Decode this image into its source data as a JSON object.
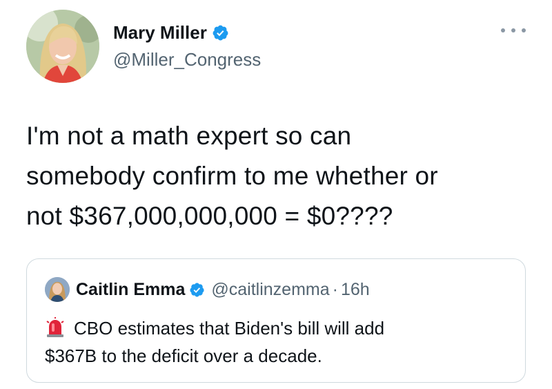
{
  "author": {
    "display_name": "Mary Miller",
    "handle": "@Miller_Congress",
    "verified": true,
    "avatar": "avatar-photo"
  },
  "header": {
    "more_icon": "more-horizontal-icon"
  },
  "tweet": {
    "lines": [
      "I'm not a math expert so can",
      "somebody confirm to me whether or",
      "not $367,000,000,000 = $0????"
    ]
  },
  "quoted_tweet": {
    "display_name": "Caitlin Emma",
    "handle": "@caitlinzemma",
    "separator": "·",
    "time": "16h",
    "verified": true,
    "emoji_icon": "police-siren-icon",
    "lines": [
      "CBO estimates that Biden's bill will add",
      "$367B to the deficit over a decade."
    ]
  },
  "colors": {
    "primary_text": "#0f1419",
    "secondary_text": "#536471",
    "verified_blue": "#1d9bf0",
    "border": "#cfd9de"
  }
}
